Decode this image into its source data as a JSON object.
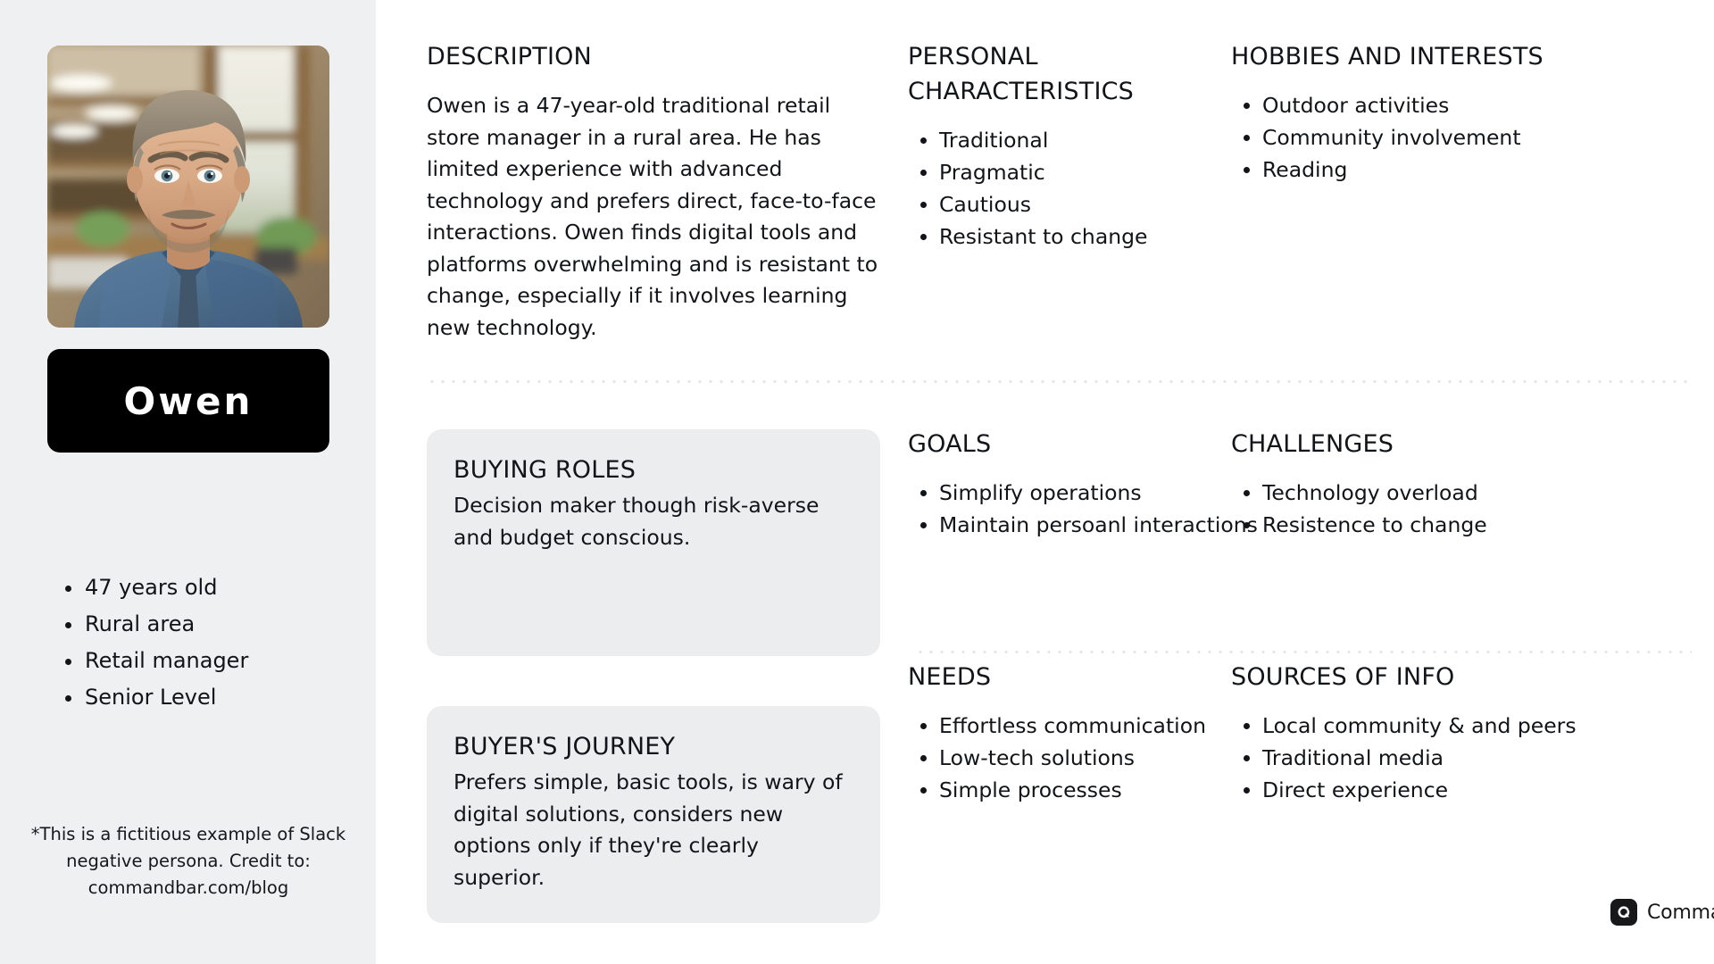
{
  "persona": {
    "name": "Owen",
    "portrait_alt": "portrait-photo",
    "facts": [
      "47 years old",
      "Rural area",
      "Retail manager",
      "Senior Level"
    ],
    "footnote": "*This is a fictitious example of Slack negative persona. Credit to: commandbar.com/blog"
  },
  "sections": {
    "description": {
      "title": "DESCRIPTION",
      "text": "Owen is a 47-year-old traditional retail store manager in a rural area. He has limited experience with advanced technology and prefers direct, face-to-face interactions. Owen finds digital tools and platforms overwhelming and is resistant to change, especially if it involves learning new technology."
    },
    "personal_characteristics": {
      "title": "PERSONAL CHARACTERISTICS",
      "items": [
        "Traditional",
        "Pragmatic",
        "Cautious",
        "Resistant to change"
      ]
    },
    "hobbies": {
      "title": "HOBBIES AND INTERESTS",
      "items": [
        "Outdoor activities",
        "Community involvement",
        "Reading"
      ]
    },
    "buying_roles": {
      "title": "BUYING ROLES",
      "text": "Decision maker though risk-averse and budget conscious."
    },
    "goals": {
      "title": "GOALS",
      "items": [
        "Simplify operations",
        "Maintain persoanl interactions"
      ]
    },
    "challenges": {
      "title": "CHALLENGES",
      "items": [
        "Technology overload",
        "Resistence to change"
      ]
    },
    "buyers_journey": {
      "title": "BUYER'S JOURNEY",
      "text": "Prefers simple, basic tools, is wary of digital solutions, considers new options only if they're clearly superior."
    },
    "needs": {
      "title": "NEEDS",
      "items": [
        "Effortless communication",
        "Low-tech solutions",
        "Simple processes"
      ]
    },
    "sources_of_info": {
      "title": "SOURCES OF INFO",
      "items": [
        "Local community & and peers",
        "Traditional media",
        "Direct experience"
      ]
    }
  },
  "branding": {
    "logo_text": "CommandBar",
    "logo_icon": "commandbar-c-icon"
  },
  "colors": {
    "sidebar_bg": "#eef0f1",
    "card_bg": "#ebedee",
    "name_card_bg": "#000000",
    "text": "#111418",
    "divider": "#e3e5e7"
  }
}
